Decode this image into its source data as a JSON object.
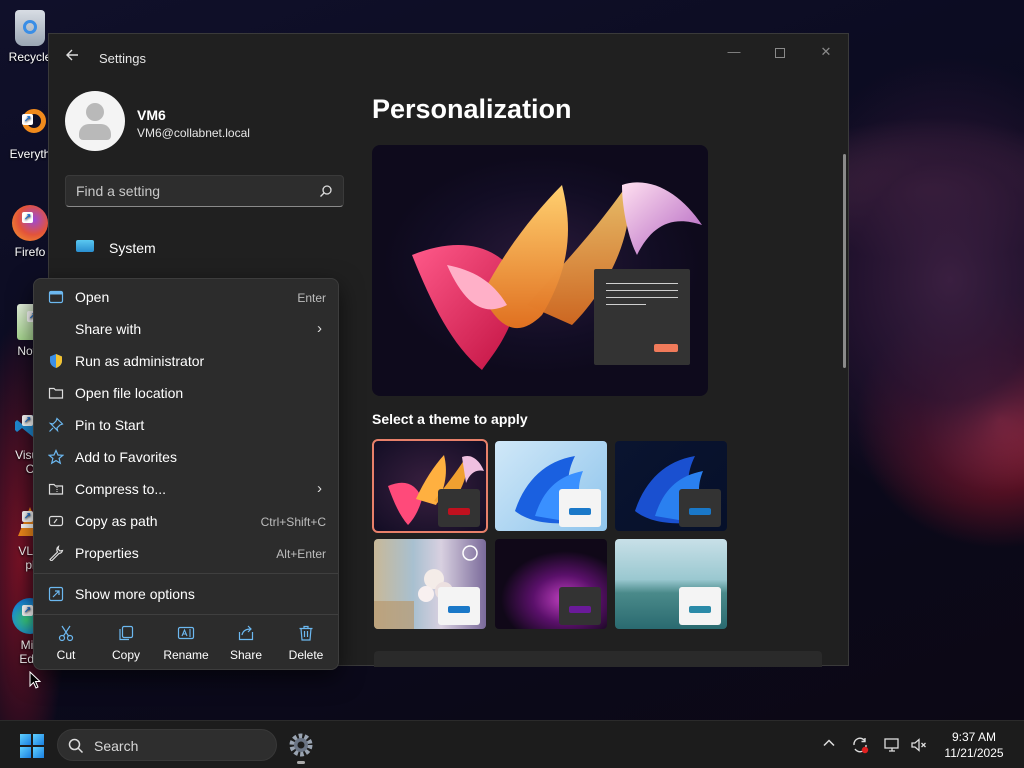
{
  "desktop": {
    "icons": [
      {
        "label": "Recycle",
        "icon": "recycle-bin-icon"
      },
      {
        "label": "Everyth",
        "icon": "everything-search-icon"
      },
      {
        "label": "Firefo",
        "icon": "firefox-icon"
      },
      {
        "label": "Note",
        "icon": "notepad-icon"
      },
      {
        "label": "Visua",
        "sublabel": "C",
        "icon": "vscode-icon"
      },
      {
        "label": "VLC",
        "sublabel": "pl",
        "icon": "vlc-icon"
      },
      {
        "label": "Mic",
        "sublabel": "Edg",
        "icon": "edge-icon"
      }
    ]
  },
  "settings": {
    "title": "Settings",
    "user": {
      "name": "VM6",
      "email": "VM6@collabnet.local"
    },
    "search": {
      "placeholder": "Find a setting"
    },
    "nav": [
      {
        "label": "System",
        "icon": "system-display-icon"
      }
    ],
    "page_heading": "Personalization",
    "theme_section_label": "Select a theme to apply",
    "themes": [
      {
        "name": "theme-glow",
        "selected": true,
        "accent": "#c0101e"
      },
      {
        "name": "theme-bloom-light",
        "selected": false,
        "accent": "#1a78c8"
      },
      {
        "name": "theme-bloom-dark",
        "selected": false,
        "accent": "#1a78c8"
      },
      {
        "name": "theme-flowers",
        "selected": false,
        "accent": "#1a78c8"
      },
      {
        "name": "theme-captured-motion",
        "selected": false,
        "accent": "#6a1a9a"
      },
      {
        "name": "theme-sunrise",
        "selected": false,
        "accent": "#2a8aa8"
      }
    ],
    "accent_color": "#e8806a"
  },
  "context_menu": {
    "items": [
      {
        "label": "Open",
        "shortcut": "Enter",
        "icon": "open-window-icon",
        "submenu": false
      },
      {
        "label": "Share with",
        "shortcut": "",
        "icon": "share-with-icon",
        "submenu": true
      },
      {
        "label": "Run as administrator",
        "shortcut": "",
        "icon": "shield-icon",
        "submenu": false
      },
      {
        "label": "Open file location",
        "shortcut": "",
        "icon": "folder-icon",
        "submenu": false
      },
      {
        "label": "Pin to Start",
        "shortcut": "",
        "icon": "pin-icon",
        "submenu": false
      },
      {
        "label": "Add to Favorites",
        "shortcut": "",
        "icon": "star-icon",
        "submenu": false
      },
      {
        "label": "Compress to...",
        "shortcut": "",
        "icon": "zip-folder-icon",
        "submenu": true
      },
      {
        "label": "Copy as path",
        "shortcut": "Ctrl+Shift+C",
        "icon": "copy-path-icon",
        "submenu": false
      },
      {
        "label": "Properties",
        "shortcut": "Alt+Enter",
        "icon": "wrench-icon",
        "submenu": false
      }
    ],
    "more_options": {
      "label": "Show more options",
      "icon": "show-more-icon"
    },
    "actions": [
      {
        "label": "Cut",
        "icon": "scissors-icon"
      },
      {
        "label": "Copy",
        "icon": "copy-icon"
      },
      {
        "label": "Rename",
        "icon": "rename-icon"
      },
      {
        "label": "Share",
        "icon": "share-icon"
      },
      {
        "label": "Delete",
        "icon": "trash-icon"
      }
    ]
  },
  "taskbar": {
    "search_label": "Search",
    "pinned": [
      {
        "name": "settings-app",
        "icon": "gear-icon",
        "active": true
      }
    ],
    "tray": [
      {
        "name": "show-hidden-icons",
        "icon": "chevron-up-icon"
      },
      {
        "name": "sync-status",
        "icon": "sync-icon"
      },
      {
        "name": "network",
        "icon": "network-icon"
      },
      {
        "name": "volume",
        "icon": "volume-muted-icon"
      }
    ],
    "time": "9:37 AM",
    "date": "11/21/2025"
  }
}
